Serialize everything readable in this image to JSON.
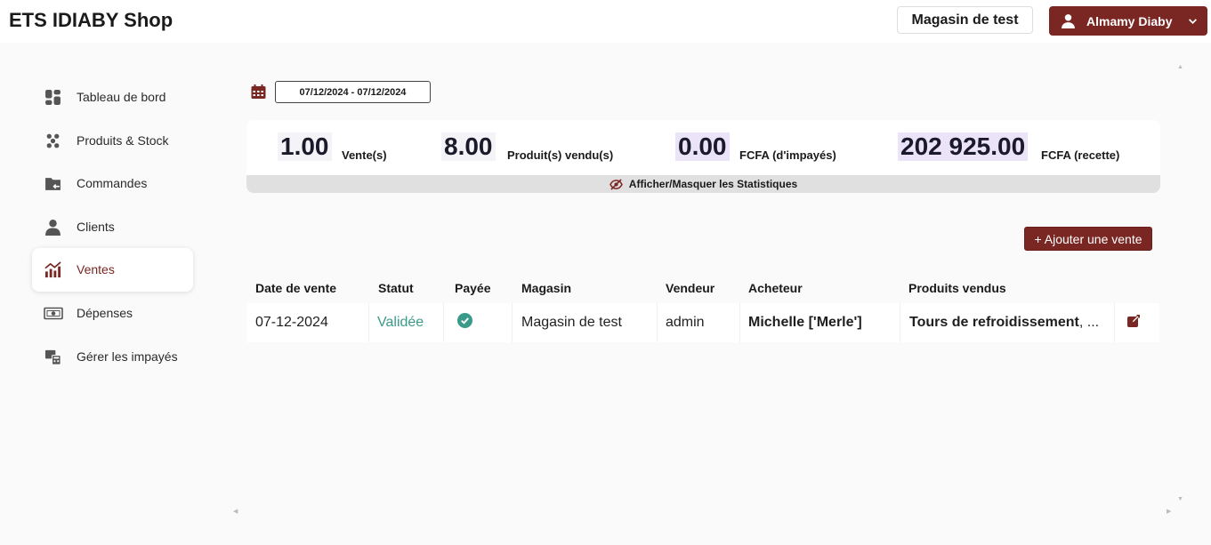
{
  "header": {
    "title": "ETS IDIABY Shop",
    "store_button": "Magasin de test",
    "user_name": "Almamy Diaby"
  },
  "sidebar": {
    "items": [
      {
        "label": "Tableau de bord",
        "icon": "dashboard-icon"
      },
      {
        "label": "Produits & Stock",
        "icon": "products-icon"
      },
      {
        "label": "Commandes",
        "icon": "folder-icon"
      },
      {
        "label": "Clients",
        "icon": "user-icon"
      },
      {
        "label": "Ventes",
        "icon": "chart-icon",
        "active": true
      },
      {
        "label": "Dépenses",
        "icon": "money-icon"
      },
      {
        "label": "Gérer les impayés",
        "icon": "calculator-icon"
      }
    ]
  },
  "filters": {
    "date_range": "07/12/2024 - 07/12/2024"
  },
  "stats": {
    "ventes_value": "1.00",
    "ventes_label": "Vente(s)",
    "produits_value": "8.00",
    "produits_label": "Produit(s) vendu(s)",
    "impayes_value": "0.00",
    "impayes_label": "FCFA (d'impayés)",
    "recette_value": "202 925.00",
    "recette_label": "FCFA (recette)",
    "toggle_label": "Afficher/Masquer les Statistiques"
  },
  "actions": {
    "add_sale": "+ Ajouter une vente"
  },
  "table": {
    "headers": {
      "date": "Date de vente",
      "statut": "Statut",
      "payee": "Payée",
      "magasin": "Magasin",
      "vendeur": "Vendeur",
      "acheteur": "Acheteur",
      "produits": "Produits vendus"
    },
    "rows": [
      {
        "date": "07-12-2024",
        "statut": "Validée",
        "payee": true,
        "magasin": "Magasin de test",
        "vendeur": "admin",
        "acheteur": "Michelle ['Merle']",
        "produits_bold": "Tours de refroidissement",
        "produits_rest": ", ..."
      }
    ]
  },
  "colors": {
    "accent": "#7a2723",
    "status_valid": "#3a9a8a",
    "paid_check": "#3a9a8a"
  }
}
